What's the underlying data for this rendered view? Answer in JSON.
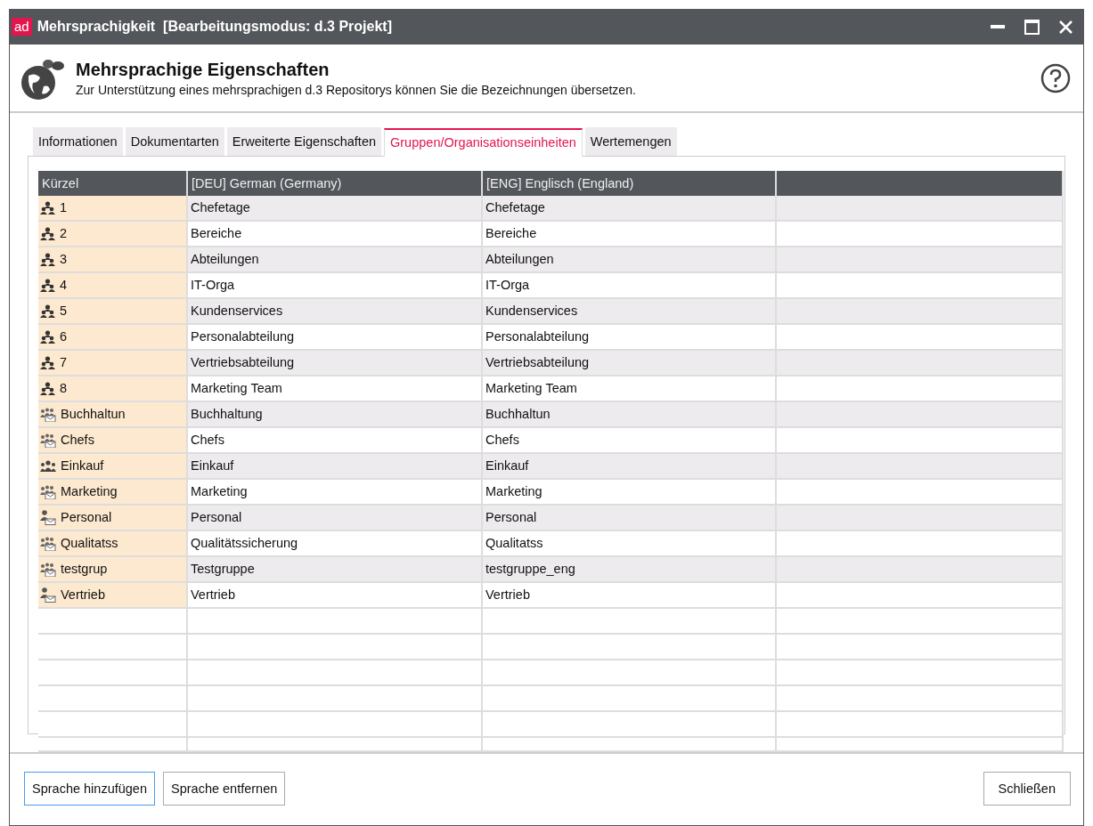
{
  "window": {
    "logo": "ad",
    "title": "Mehrsprachigkeit  [Bearbeitungsmodus: d.3 Projekt]"
  },
  "header": {
    "title": "Mehrsprachige Eigenschaften",
    "subtitle": "Zur Unterstützung eines mehrsprachigen d.3 Repositorys können Sie die Bezeichnungen übersetzen."
  },
  "tabs": [
    {
      "label": "Informationen",
      "selected": false
    },
    {
      "label": "Dokumentarten",
      "selected": false
    },
    {
      "label": "Erweiterte Eigenschaften",
      "selected": false
    },
    {
      "label": "Gruppen/Organisationseinheiten",
      "selected": true
    },
    {
      "label": "Wertemengen",
      "selected": false
    }
  ],
  "table": {
    "columns": [
      "Kürzel",
      "[DEU] German (Germany)",
      "[ENG] Englisch (England)"
    ],
    "rows": [
      {
        "kind": "org",
        "key": "1",
        "deu": "Chefetage",
        "eng": "Chefetage"
      },
      {
        "kind": "org",
        "key": "2",
        "deu": "Bereiche",
        "eng": "Bereiche"
      },
      {
        "kind": "org",
        "key": "3",
        "deu": "Abteilungen",
        "eng": "Abteilungen"
      },
      {
        "kind": "org",
        "key": "4",
        "deu": "IT-Orga",
        "eng": "IT-Orga"
      },
      {
        "kind": "org",
        "key": "5",
        "deu": "Kundenservices",
        "eng": "Kundenservices"
      },
      {
        "kind": "org",
        "key": "6",
        "deu": "Personalabteilung",
        "eng": "Personalabteilung"
      },
      {
        "kind": "org",
        "key": "7",
        "deu": "Vertriebsabteilung",
        "eng": "Vertriebsabteilung"
      },
      {
        "kind": "org",
        "key": "8",
        "deu": "Marketing Team",
        "eng": "Marketing Team"
      },
      {
        "kind": "group-mail",
        "key": "Buchhaltun",
        "deu": "Buchhaltung",
        "eng": "Buchhaltun"
      },
      {
        "kind": "group-mail",
        "key": "Chefs",
        "deu": "Chefs",
        "eng": "Chefs"
      },
      {
        "kind": "group",
        "key": "Einkauf",
        "deu": "Einkauf",
        "eng": "Einkauf"
      },
      {
        "kind": "group-mail",
        "key": "Marketing",
        "deu": "Marketing",
        "eng": "Marketing"
      },
      {
        "kind": "person-mail",
        "key": "Personal",
        "deu": "Personal",
        "eng": "Personal"
      },
      {
        "kind": "group-mail",
        "key": "Qualitatss",
        "deu": "Qualitätssicherung",
        "eng": "Qualitatss"
      },
      {
        "kind": "group-mail",
        "key": "testgrup",
        "deu": "Testgruppe",
        "eng": "testgruppe_eng"
      },
      {
        "kind": "person-mail",
        "key": "Vertrieb",
        "deu": "Vertrieb",
        "eng": "Vertrieb"
      }
    ]
  },
  "buttons": [
    {
      "label": "Sprache hinzufügen",
      "focused": true
    },
    {
      "label": "Sprache entfernen",
      "focused": false
    }
  ],
  "close_button": {
    "label": "Schließen"
  }
}
